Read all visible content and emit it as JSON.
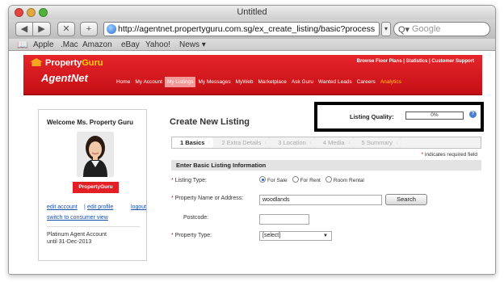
{
  "browser": {
    "window_title": "Untitled",
    "url": "http://agentnet.propertyguru.com.sg/ex_create_listing/basic?process",
    "search_placeholder": "Google",
    "bookmarks": [
      "Apple",
      ".Mac",
      "Amazon",
      "eBay",
      "Yahoo!",
      "News ▾"
    ]
  },
  "site": {
    "logo_prefix": "Property",
    "logo_suffix": "Guru",
    "product": "AgentNet",
    "top_links": "Browse Floor Plans  |  Statistics  |  Customer Support",
    "nav": [
      "Home",
      "My Account",
      "My Listings",
      "My Messages",
      "MyWeb",
      "Marketplace",
      "Ask Guru",
      "Wanted Leads",
      "Careers",
      "Analytics"
    ],
    "active_nav": "My Listings",
    "accent_color": "#e31e24"
  },
  "sidebar": {
    "welcome": "Welcome Ms. Property Guru",
    "badge": "PropertyGuru",
    "edit_account": "edit account",
    "edit_profile": "edit profile",
    "logout": "logout",
    "switch_view": "switch to consumer view",
    "plan_line1": "Platinum Agent Account",
    "plan_line2": "until 31-Dec-2013"
  },
  "form": {
    "title": "Create New Listing",
    "quality_label": "Listing Quality:",
    "quality_value": "0%",
    "quality_fraction": 0,
    "steps": [
      "1 Basics",
      "2 Extra Details",
      "3 Location",
      "4 Media",
      "5 Summary"
    ],
    "active_step": 0,
    "required_note": "indicates required field",
    "section_title": "Enter Basic Listing Information",
    "listing_type_label": "Listing Type:",
    "listing_type_options": [
      "For Sale",
      "For Rent",
      "Room Rental"
    ],
    "listing_type_selected": "For Sale",
    "property_label": "Property Name or Address:",
    "property_value": "woodlands",
    "search_button": "Search",
    "postcode_label": "Postcode:",
    "postcode_value": "",
    "property_type_label": "Property Type:",
    "property_type_value": "[select]"
  }
}
